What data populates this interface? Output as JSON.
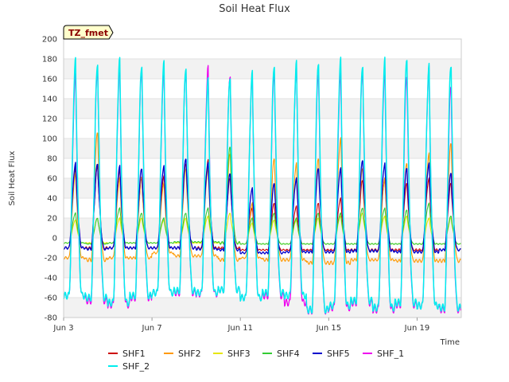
{
  "chart_data": {
    "type": "line",
    "title": "Soil Heat Flux",
    "xlabel": "Time",
    "ylabel": "Soil Heat Flux",
    "tag": "TZ_fmet",
    "xlim": [
      "2024-06-03",
      "2024-06-21"
    ],
    "ylim": [
      -80,
      200
    ],
    "ytick_step": 20,
    "yticks": [
      "-80",
      "-60",
      "-40",
      "-20",
      "0",
      "20",
      "40",
      "60",
      "80",
      "100",
      "120",
      "140",
      "160",
      "180",
      "200"
    ],
    "xticks": [
      {
        "date": "2024-06-03",
        "label": "Jun 3"
      },
      {
        "date": "2024-06-07",
        "label": "Jun 7"
      },
      {
        "date": "2024-06-11",
        "label": "Jun 11"
      },
      {
        "date": "2024-06-15",
        "label": "Jun 15"
      },
      {
        "date": "2024-06-19",
        "label": "Jun 19"
      }
    ],
    "grid": true,
    "band_background": true,
    "legend_position": "bottom",
    "days": [
      "2024-06-03",
      "2024-06-04",
      "2024-06-05",
      "2024-06-06",
      "2024-06-07",
      "2024-06-08",
      "2024-06-09",
      "2024-06-10",
      "2024-06-11",
      "2024-06-12",
      "2024-06-13",
      "2024-06-14",
      "2024-06-15",
      "2024-06-16",
      "2024-06-17",
      "2024-06-18",
      "2024-06-19",
      "2024-06-20"
    ],
    "series": [
      {
        "name": "SHF1",
        "color": "#cc0000",
        "width": 1.1,
        "daily_max": [
          70,
          72,
          68,
          60,
          62,
          75,
          78,
          60,
          30,
          35,
          32,
          35,
          40,
          58,
          60,
          55,
          60,
          55
        ],
        "daily_min": [
          -10,
          -10,
          -10,
          -10,
          -10,
          -10,
          -10,
          -10,
          -12,
          -12,
          -12,
          -12,
          -12,
          -12,
          -12,
          -12,
          -12,
          -12
        ]
      },
      {
        "name": "SHF2",
        "color": "#ff9900",
        "width": 1.1,
        "daily_max": [
          65,
          107,
          60,
          62,
          55,
          70,
          70,
          85,
          35,
          80,
          75,
          80,
          100,
          70,
          60,
          75,
          85,
          95
        ],
        "daily_min": [
          -20,
          -22,
          -20,
          -20,
          -15,
          -18,
          -18,
          -22,
          -20,
          -22,
          -22,
          -25,
          -25,
          -22,
          -22,
          -23,
          -23,
          -23
        ]
      },
      {
        "name": "SHF3",
        "color": "#e6e600",
        "width": 1.1,
        "daily_max": [
          18,
          20,
          20,
          20,
          18,
          20,
          22,
          25,
          15,
          18,
          18,
          20,
          22,
          25,
          22,
          22,
          20,
          20
        ],
        "daily_min": [
          -5,
          -5,
          -5,
          -5,
          -5,
          -5,
          -5,
          -5,
          -6,
          -6,
          -6,
          -6,
          -6,
          -6,
          -6,
          -6,
          -6,
          -6
        ]
      },
      {
        "name": "SHF4",
        "color": "#33cc33",
        "width": 1.1,
        "daily_max": [
          25,
          20,
          30,
          25,
          20,
          25,
          30,
          92,
          20,
          25,
          20,
          25,
          25,
          30,
          30,
          28,
          35,
          22
        ],
        "daily_min": [
          -5,
          -6,
          -5,
          -5,
          -5,
          -4,
          -4,
          -5,
          -6,
          -6,
          -6,
          -6,
          -6,
          -6,
          -6,
          -6,
          -6,
          -6
        ]
      },
      {
        "name": "SHF5",
        "color": "#0000cc",
        "width": 1.3,
        "daily_max": [
          75,
          75,
          72,
          70,
          72,
          80,
          75,
          65,
          50,
          55,
          60,
          70,
          70,
          78,
          75,
          70,
          75,
          65
        ],
        "daily_min": [
          -10,
          -11,
          -10,
          -10,
          -10,
          -10,
          -11,
          -12,
          -15,
          -15,
          -14,
          -14,
          -14,
          -13,
          -13,
          -14,
          -14,
          -12
        ]
      },
      {
        "name": "SHF_1",
        "color": "#ee00ee",
        "width": 1.3,
        "daily_max": [
          165,
          172,
          170,
          170,
          168,
          170,
          170,
          165,
          162,
          168,
          172,
          168,
          165,
          170,
          168,
          165,
          170,
          155
        ],
        "daily_min": [
          -58,
          -63,
          -67,
          -60,
          -55,
          -55,
          -56,
          -52,
          -60,
          -58,
          -65,
          -73,
          -70,
          -65,
          -72,
          -67,
          -68,
          -72
        ]
      },
      {
        "name": "SHF_2",
        "color": "#00eeee",
        "width": 1.5,
        "daily_max": [
          178,
          177,
          178,
          175,
          175,
          173,
          158,
          163,
          165,
          175,
          175,
          178,
          178,
          175,
          178,
          182,
          172,
          175
        ],
        "daily_min": [
          -58,
          -60,
          -65,
          -58,
          -55,
          -53,
          -55,
          -52,
          -60,
          -55,
          -58,
          -72,
          -68,
          -63,
          -70,
          -65,
          -68,
          -70
        ]
      }
    ]
  }
}
